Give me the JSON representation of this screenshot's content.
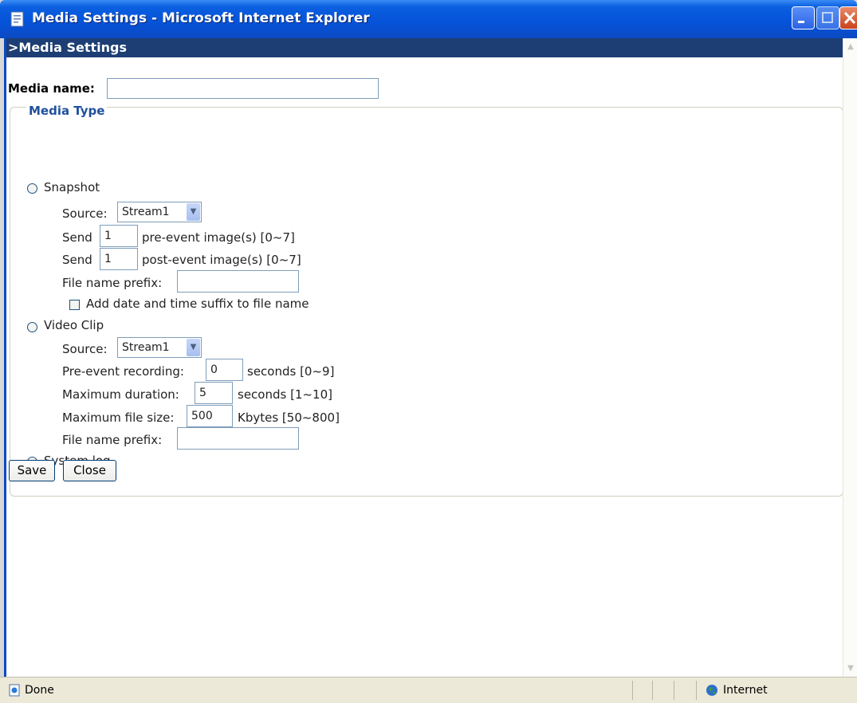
{
  "window": {
    "title": "Media Settings - Microsoft Internet Explorer"
  },
  "page": {
    "header": ">Media Settings",
    "media_name_label": "Media name:",
    "media_name_value": "",
    "media_type_legend": "Media Type"
  },
  "snapshot": {
    "label": "Snapshot",
    "selected": false,
    "source_label": "Source:",
    "source_value": "Stream1",
    "send_label": "Send",
    "pre_value": "1",
    "pre_suffix": "pre-event image(s) [0~7]",
    "post_value": "1",
    "post_suffix": "post-event image(s) [0~7]",
    "prefix_label": "File name prefix:",
    "prefix_value": "",
    "date_suffix_label": "Add date and time suffix to file name",
    "date_suffix_checked": false
  },
  "video_clip": {
    "label": "Video Clip",
    "selected": false,
    "source_label": "Source:",
    "source_value": "Stream1",
    "pre_event_label": "Pre-event recording:",
    "pre_event_value": "0",
    "pre_event_suffix": "seconds [0~9]",
    "max_duration_label": "Maximum duration:",
    "max_duration_value": "5",
    "max_duration_suffix": "seconds [1~10]",
    "max_size_label": "Maximum file size:",
    "max_size_value": "500",
    "max_size_suffix": "Kbytes [50~800]",
    "prefix_label": "File name prefix:",
    "prefix_value": ""
  },
  "system_log": {
    "label": "System log",
    "selected": true
  },
  "buttons": {
    "save": "Save",
    "close": "Close"
  },
  "status": {
    "text": "Done",
    "zone": "Internet"
  },
  "colors": {
    "title_bar": "#0a5fe0",
    "page_header": "#1c3e74",
    "legend_text": "#1f4f9c"
  },
  "icons": {
    "app": "ie-page-icon",
    "status": "ie-page-icon",
    "zone": "globe-icon"
  }
}
